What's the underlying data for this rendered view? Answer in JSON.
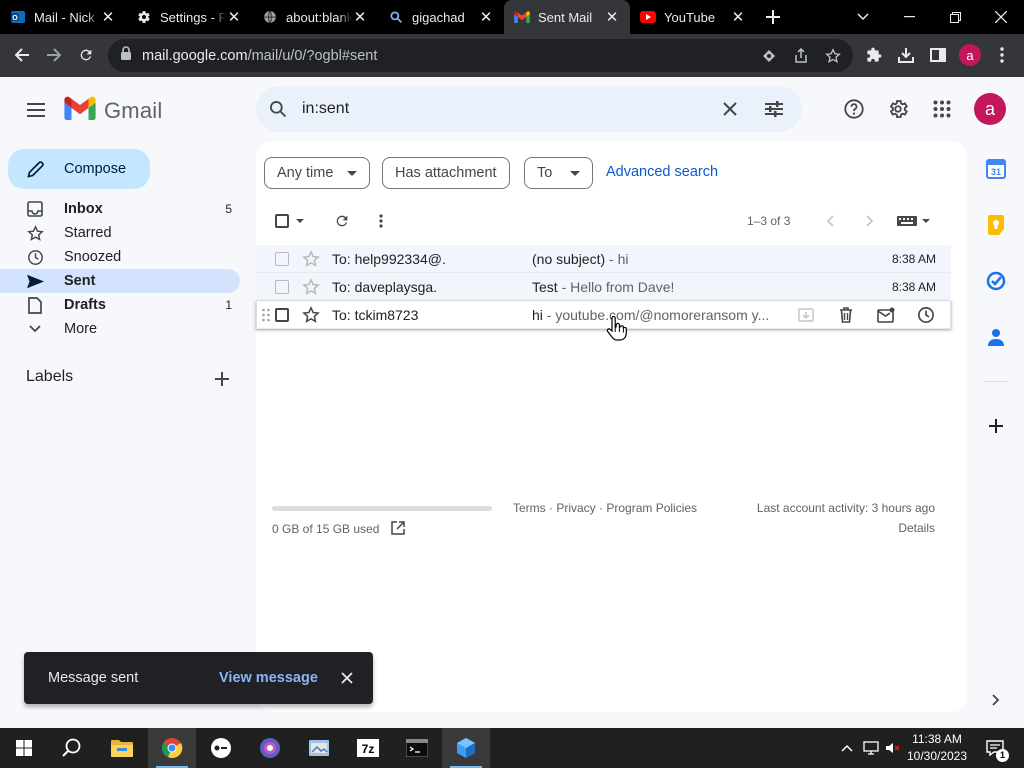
{
  "browser": {
    "tabs": [
      {
        "title": "Mail - Nick",
        "favicon": "outlook-icon",
        "active": false
      },
      {
        "title": "Settings - Privacy",
        "favicon": "gear-icon",
        "active": false
      },
      {
        "title": "about:blank",
        "favicon": "globe-icon",
        "active": false
      },
      {
        "title": "gigachad",
        "favicon": "search-icon",
        "active": false
      },
      {
        "title": "Sent Mail",
        "favicon": "gmail-icon",
        "active": true
      },
      {
        "title": "YouTube",
        "favicon": "youtube-icon",
        "active": false
      }
    ],
    "url_host": "mail.google.com",
    "url_path": "/mail/u/0/?ogbl#sent",
    "profile_initial": "a"
  },
  "gmail": {
    "app_name": "Gmail",
    "search_query": "in:sent",
    "avatar_initial": "a",
    "compose_label": "Compose",
    "nav": [
      {
        "label": "Inbox",
        "count": "5",
        "icon": "inbox-icon",
        "bold": true,
        "active": false
      },
      {
        "label": "Starred",
        "count": "",
        "icon": "star-icon",
        "bold": false,
        "active": false
      },
      {
        "label": "Snoozed",
        "count": "",
        "icon": "clock-icon",
        "bold": false,
        "active": false
      },
      {
        "label": "Sent",
        "count": "",
        "icon": "send-icon",
        "bold": true,
        "active": true
      },
      {
        "label": "Drafts",
        "count": "1",
        "icon": "draft-icon",
        "bold": true,
        "active": false
      },
      {
        "label": "More",
        "count": "",
        "icon": "chevron-down-icon",
        "bold": false,
        "active": false
      }
    ],
    "labels_heading": "Labels",
    "filters": {
      "any_time": "Any time",
      "has_attachment": "Has attachment",
      "to": "To",
      "advanced_search": "Advanced search"
    },
    "pagination": "1–3 of 3",
    "messages": [
      {
        "to": "To: help992334@.",
        "subject": "(no subject)",
        "snippet": " - hi",
        "time": "8:38 AM"
      },
      {
        "to": "To: daveplaysga.",
        "subject": "Test",
        "snippet": " - Hello from Dave!",
        "time": "8:38 AM"
      },
      {
        "to": "To: tckim8723",
        "subject": "hi",
        "snippet": " - youtube.com/@nomoreransom y...",
        "time": ""
      }
    ],
    "footer": {
      "storage": "0 GB of 15 GB used",
      "terms": "Terms",
      "privacy": "Privacy",
      "program_policies": "Program Policies",
      "last_activity": "Last account activity: 3 hours ago",
      "details": "Details"
    },
    "snackbar": {
      "message": "Message sent",
      "action": "View message"
    }
  },
  "taskbar": {
    "time": "11:38 AM",
    "date": "10/30/2023",
    "notification_count": "1"
  },
  "colors": {
    "gmail_bg": "#f6f8fc",
    "accent_blue": "#0b57d0",
    "compose_bg": "#c2e7ff",
    "nav_active": "#d3e3fd",
    "avatar": "#c2185b"
  }
}
